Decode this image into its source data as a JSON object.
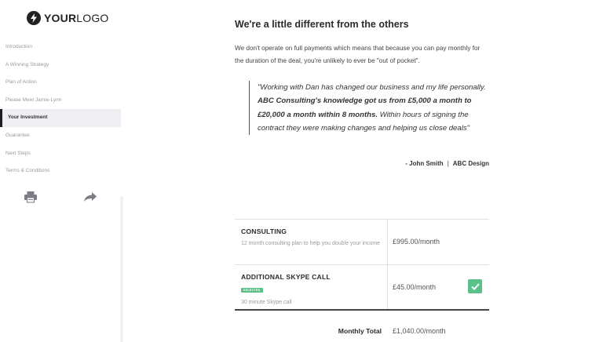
{
  "logo": {
    "bold": "YOUR",
    "light": "LOGO"
  },
  "sidebar": {
    "items": [
      {
        "label": "Introduction"
      },
      {
        "label": "A Winning Strategy"
      },
      {
        "label": "Plan of Action"
      },
      {
        "label": "Please Meet Jamie-Lynn"
      },
      {
        "label": "Your Investment",
        "active": true
      },
      {
        "label": "Guarantee"
      },
      {
        "label": "Next Steps"
      },
      {
        "label": "Terms & Conditions"
      }
    ],
    "tools": {
      "print_icon": "printer-icon",
      "share_icon": "share-arrow-icon"
    }
  },
  "main": {
    "heading": "We're a little different from the others",
    "intro": "We don't operate on full payments which means that because you can pay monthly for the duration of the deal, you're unlikely to ever be \"out of pocket\".",
    "quote": {
      "part1": "\"Working with Dan has changed our business and my life personally. ",
      "bold": "ABC Consulting's knowledge got us from £5,000 a month to £20,000 a month within 8 months.",
      "part2": " Within hours of signing the contract they were making changes and helping us close deals\""
    },
    "attribution": {
      "name": "- John Smith",
      "separator": "|",
      "company": "ABC Design"
    }
  },
  "pricing": {
    "items": [
      {
        "title": "CONSULTING",
        "subtitle": "12 month consulting plan to help you double your income",
        "price": "£995.00/month",
        "selected": false
      },
      {
        "title": "ADDITIONAL SKYPE CALL",
        "badge": "SELECTED",
        "subtitle": "30 minute Skype call",
        "price": "£45.00/month",
        "selected": true
      }
    ],
    "total_label": "Monthly Total",
    "total_value": "£1,040.00/month"
  },
  "colors": {
    "accent": "#5bc08a",
    "active_bar": "#1e1e24",
    "muted": "#9a9aa2"
  }
}
